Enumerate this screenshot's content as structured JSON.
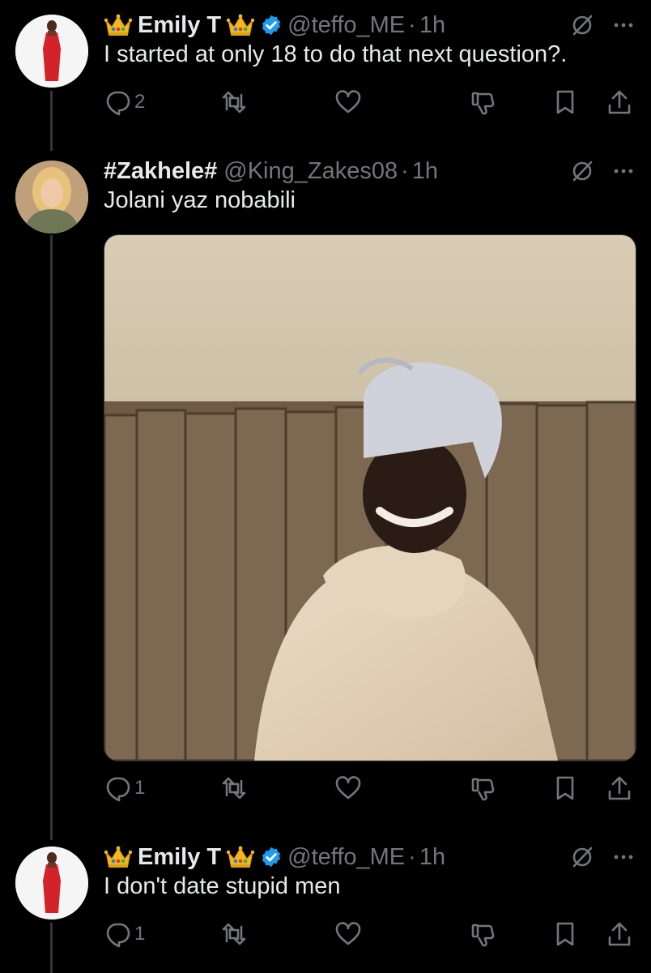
{
  "tweets": [
    {
      "name": "Emily T",
      "handle": "@teffo_ME",
      "time": "1h",
      "text": "I started at only 18 to do that next question?.",
      "replies": "2",
      "retweets": "",
      "likes": ""
    },
    {
      "name": "#Zakhele#",
      "handle": "@King_Zakes08",
      "time": "1h",
      "text": "Jolani yaz nobabili",
      "replies": "1",
      "retweets": "",
      "likes": ""
    },
    {
      "name": "Emily T",
      "handle": "@teffo_ME",
      "time": "1h",
      "text": "I don't date stupid men",
      "replies": "1",
      "retweets": "",
      "likes": ""
    }
  ],
  "icons": {
    "crown": "crown-emoji-icon",
    "verified": "verified-badge-icon",
    "grok": "grok-icon",
    "more": "more-icon",
    "reply": "reply-icon",
    "retweet": "retweet-icon",
    "like": "like-icon",
    "dislike": "dislike-icon",
    "bookmark": "bookmark-icon",
    "share": "share-icon"
  },
  "colors": {
    "background": "#000000",
    "text": "#e7e9ea",
    "secondary": "#71767b",
    "verified": "#1d9bf0",
    "thread_line": "#333639"
  }
}
